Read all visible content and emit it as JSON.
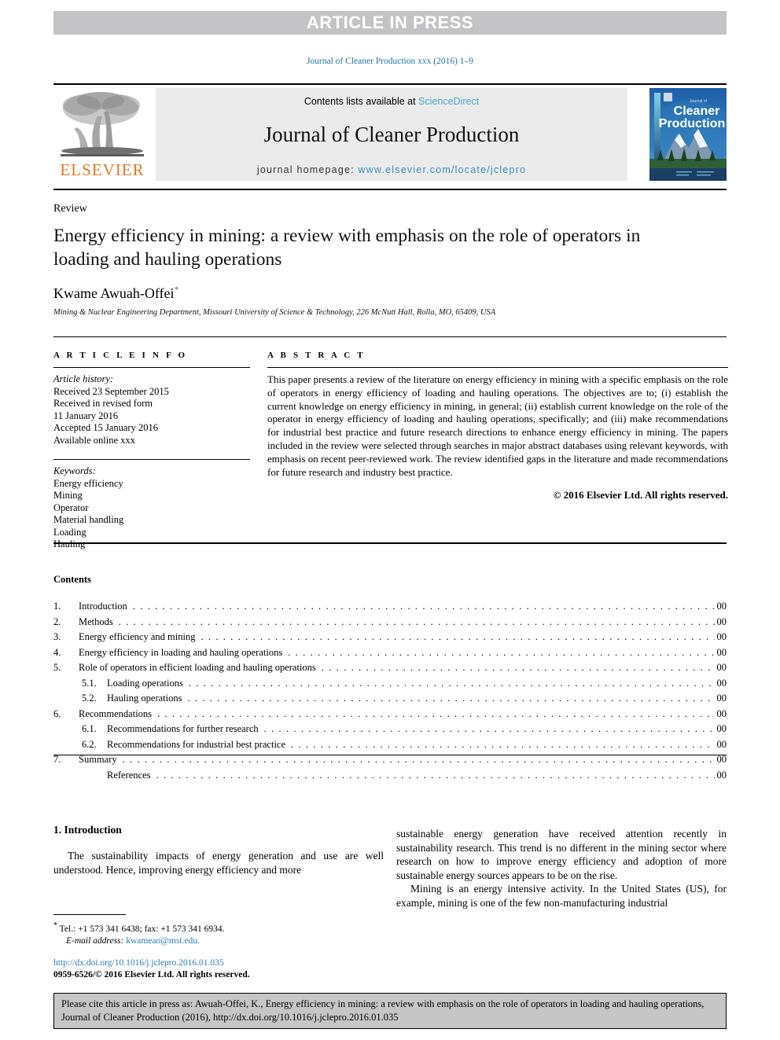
{
  "banner": {
    "text": "ARTICLE IN PRESS"
  },
  "running_head": "Journal of Cleaner Production xxx (2016) 1–9",
  "masthead": {
    "contents_prefix": "Contents lists available at ",
    "sciencedirect": "ScienceDirect",
    "journal_title": "Journal of Cleaner Production",
    "homepage_label": "journal homepage: ",
    "homepage_url": "www.elsevier.com/locate/jclepro",
    "publisher_wordmark": "ELSEVIER",
    "cover_journal_of": "Journal of",
    "cover_line1": "Cleaner",
    "cover_line2": "Production"
  },
  "article": {
    "type": "Review",
    "title": "Energy efficiency in mining: a review with emphasis on the role of operators in loading and hauling operations",
    "author": "Kwame Awuah-Offei",
    "author_footnote_marker": "*",
    "affiliation": "Mining & Nuclear Engineering Department, Missouri University of Science & Technology, 226 McNutt Hall, Rolla, MO, 65409, USA"
  },
  "info": {
    "heading": "A R T I C L E  I N F O",
    "history_label": "Article history:",
    "history_lines": [
      "Received 23 September 2015",
      "Received in revised form",
      "11 January 2016",
      "Accepted 15 January 2016",
      "Available online xxx"
    ],
    "keywords_label": "Keywords:",
    "keywords": [
      "Energy efficiency",
      "Mining",
      "Operator",
      "Material handling",
      "Loading",
      "Hauling"
    ]
  },
  "abstract": {
    "heading": "A B S T R A C T",
    "body": "This paper presents a review of the literature on energy efficiency in mining with a specific emphasis on the role of operators in energy efficiency of loading and hauling operations. The objectives are to; (i) establish the current knowledge on energy efficiency in mining, in general; (ii) establish current knowledge on the role of the operator in energy efficiency of loading and hauling operations, specifically; and (iii) make recommendations for industrial best practice and future research directions to enhance energy efficiency in mining. The papers included in the review were selected through searches in major abstract databases using relevant keywords, with emphasis on recent peer-reviewed work. The review identified gaps in the literature and made recommendations for future research and industry best practice.",
    "copyright": "© 2016 Elsevier Ltd. All rights reserved."
  },
  "contents": {
    "title": "Contents",
    "entries": [
      {
        "num": "1.",
        "label": "Introduction",
        "page": "00",
        "level": 1
      },
      {
        "num": "2.",
        "label": "Methods",
        "page": "00",
        "level": 1
      },
      {
        "num": "3.",
        "label": "Energy efficiency and mining",
        "page": "00",
        "level": 1
      },
      {
        "num": "4.",
        "label": "Energy efficiency in loading and hauling operations",
        "page": "00",
        "level": 1
      },
      {
        "num": "5.",
        "label": "Role of operators in efficient loading and hauling operations",
        "page": "00",
        "level": 1
      },
      {
        "num": "5.1.",
        "label": "Loading operations",
        "page": "00",
        "level": 2
      },
      {
        "num": "5.2.",
        "label": "Hauling operations",
        "page": "00",
        "level": 2
      },
      {
        "num": "6.",
        "label": "Recommendations",
        "page": "00",
        "level": 1
      },
      {
        "num": "6.1.",
        "label": "Recommendations for further research",
        "page": "00",
        "level": 2
      },
      {
        "num": "6.2.",
        "label": "Recommendations for industrial best practice",
        "page": "00",
        "level": 2
      },
      {
        "num": "7.",
        "label": "Summary",
        "page": "00",
        "level": 1
      },
      {
        "num": "",
        "label": "References",
        "page": "00",
        "level": 2
      }
    ]
  },
  "body": {
    "section_heading": "1. Introduction",
    "left_paragraph": "The sustainability impacts of energy generation and use are well understood. Hence, improving energy efficiency and more",
    "right_paragraph_1": "sustainable energy generation have received attention recently in sustainability research. This trend is no different in the mining sector where research on how to improve energy efficiency and adoption of more sustainable energy sources appears to be on the rise.",
    "right_paragraph_2": "Mining is an energy intensive activity. In the United States (US), for example, mining is one of the few non-manufacturing industrial"
  },
  "footnote": {
    "marker": "*",
    "contact": "Tel.: +1 573 341 6438; fax: +1 573 341 6934.",
    "email_label": "E-mail address:",
    "email": "kwameao@mst.edu."
  },
  "doi": {
    "url": "http://dx.doi.org/10.1016/j.jclepro.2016.01.035",
    "issn_line": "0959-6526/© 2016 Elsevier Ltd. All rights reserved."
  },
  "cite_box": {
    "text": "Please cite this article in press as: Awuah-Offei, K., Energy efficiency in mining: a review with emphasis on the role of operators in loading and hauling operations, Journal of Cleaner Production (2016), http://dx.doi.org/10.1016/j.jclepro.2016.01.035"
  },
  "colors": {
    "banner_bg": "#c3c3c5",
    "link_blue": "#2b7bb9",
    "sciencedirect_blue": "#4da6c8",
    "elsevier_orange": "#e87722",
    "masthead_bg": "#ebebeb",
    "cite_box_bg": "#c6c6c6"
  }
}
